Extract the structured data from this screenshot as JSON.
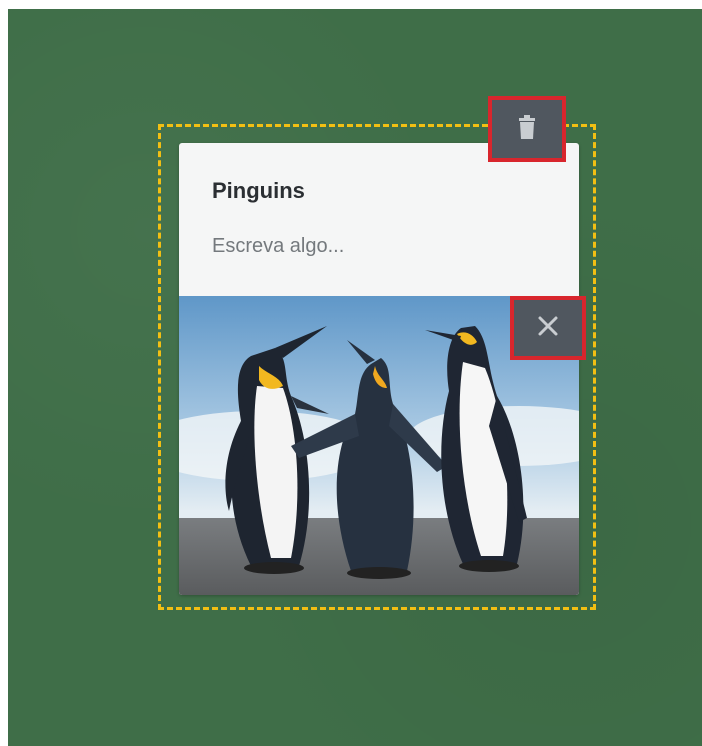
{
  "note": {
    "title": "Pinguins",
    "placeholder": "Escreva algo..."
  },
  "controls": {
    "delete_icon": "trash-icon",
    "remove_image_icon": "close-icon"
  },
  "colors": {
    "board": "#3f6e48",
    "selection_outline": "#f2bf13",
    "button_background": "#50575f",
    "button_highlight": "#d8262d"
  }
}
